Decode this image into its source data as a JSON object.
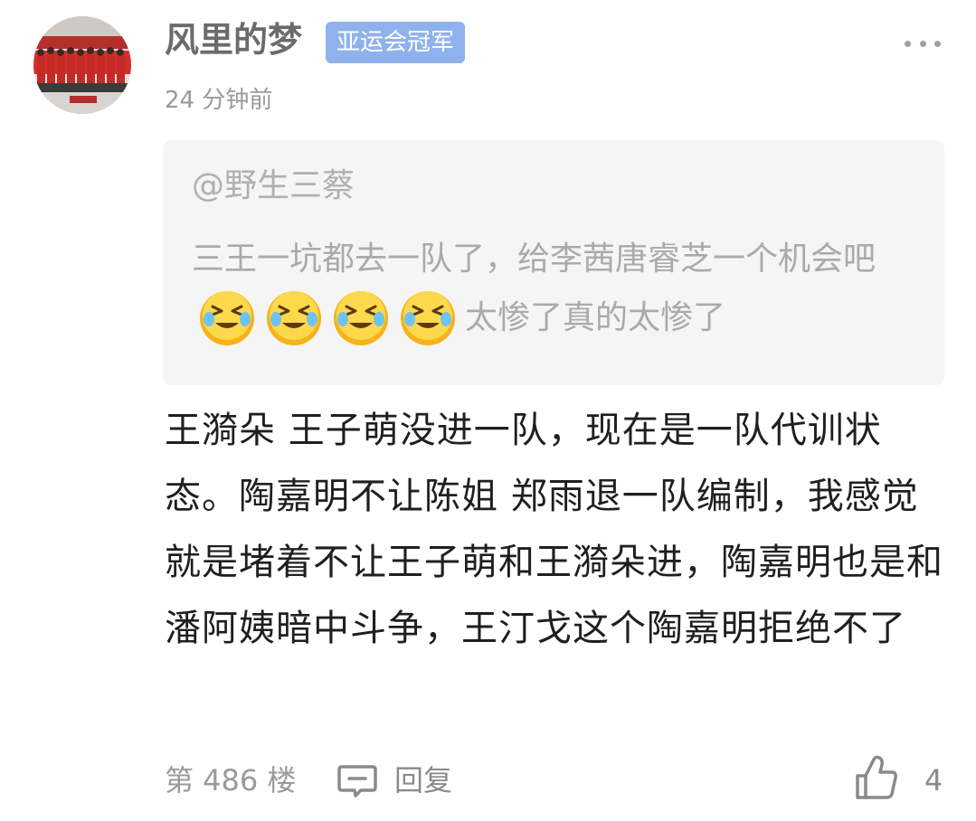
{
  "comment": {
    "username": "风里的梦",
    "badge": "亚运会冠军",
    "time": "24 分钟前",
    "quote": {
      "author": "@野生三蔡",
      "text_before_emoji": "三王一坑都去一队了，给李茜唐睿芝一个机会吧",
      "emoji_name": "laughing-crying-emoji",
      "emoji_count": 4,
      "text_after_emoji": "太惨了真的太惨了"
    },
    "content": "王漪朵 王子萌没进一队，现在是一队代训状态。陶嘉明不让陈姐 郑雨退一队编制，我感觉就是堵着不让王子萌和王漪朵进，陶嘉明也是和潘阿姨暗中斗争，王汀戈这个陶嘉明拒绝不了",
    "floor": "第 486 楼",
    "reply_label": "回复",
    "like_count": "4"
  },
  "icons": {
    "more": "more-dots-icon",
    "reply": "comment-bubble-icon",
    "like": "thumbs-up-icon"
  },
  "colors": {
    "badge_bg": "#8fb2ec",
    "quote_bg": "#f5f5f5",
    "username": "#6b6b6b",
    "emoji_face": "#f7b21b"
  }
}
